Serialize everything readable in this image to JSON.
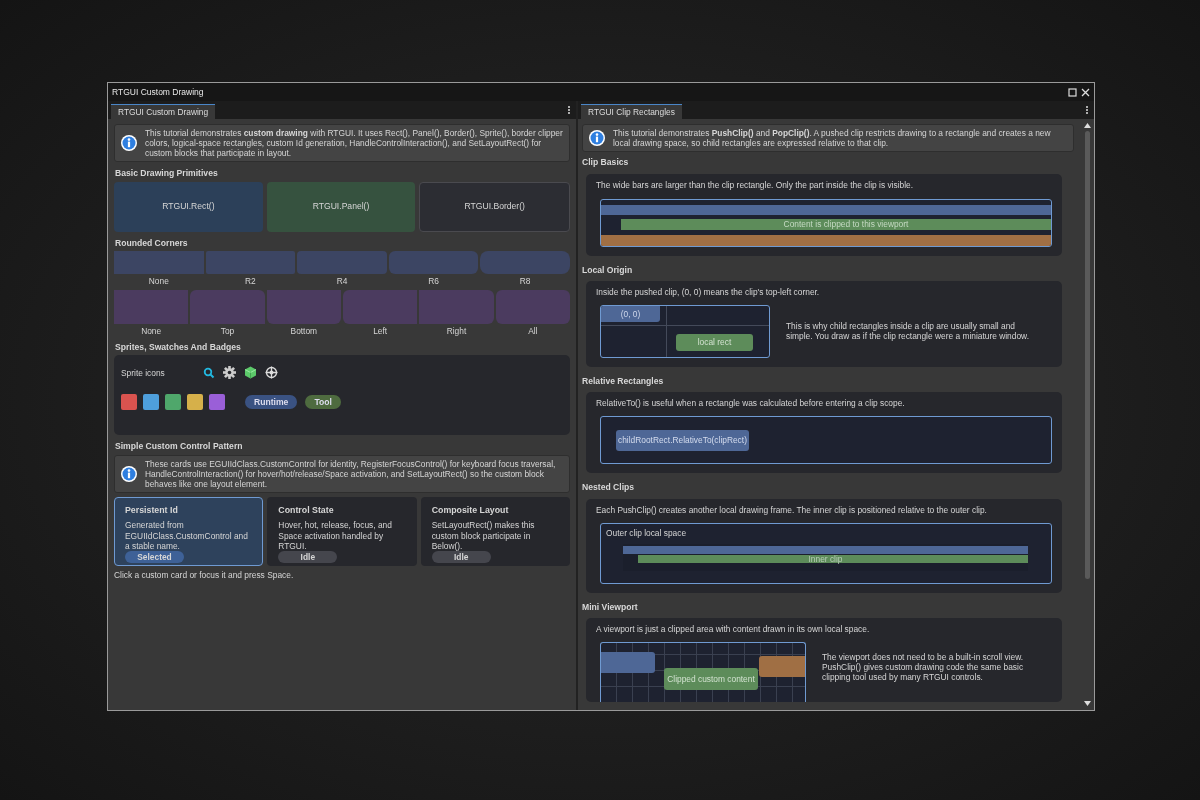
{
  "window": {
    "title": "RTGUI Custom Drawing"
  },
  "left_panel": {
    "tab": {
      "label": "RTGUI Custom Drawing",
      "selected": true
    },
    "intro": "This tutorial demonstrates **custom drawing** with RTGUI. It uses Rect(), Panel(), Border(), Sprite(), border clipper colors, logical-space rectangles, custom Id generation, HandleControlInteraction(), and SetLayoutRect() for custom blocks that participate in layout.",
    "primitives": {
      "heading": "Basic Drawing Primitives",
      "items": [
        {
          "label": "RTGUI.Rect()",
          "kind": "rect"
        },
        {
          "label": "RTGUI.Panel()",
          "kind": "panel"
        },
        {
          "label": "RTGUI.Border()",
          "kind": "border"
        }
      ]
    },
    "rounded": {
      "heading": "Rounded Corners",
      "radius_row": [
        {
          "label": "None",
          "kind": "r0"
        },
        {
          "label": "R2",
          "kind": "r2"
        },
        {
          "label": "R4",
          "kind": "r4"
        },
        {
          "label": "R6",
          "kind": "r6"
        },
        {
          "label": "R8",
          "kind": "r8"
        }
      ],
      "side_row": [
        {
          "label": "None",
          "kind": "none"
        },
        {
          "label": "Top",
          "kind": "top"
        },
        {
          "label": "Bottom",
          "kind": "bottom"
        },
        {
          "label": "Left",
          "kind": "left"
        },
        {
          "label": "Right",
          "kind": "right"
        },
        {
          "label": "All",
          "kind": "all"
        }
      ]
    },
    "sprites": {
      "heading": "Sprites, Swatches And Badges",
      "label": "Sprite icons",
      "swatches": [
        {
          "color": "#d9534f"
        },
        {
          "color": "#4e9fdc"
        },
        {
          "color": "#4fa76b"
        },
        {
          "color": "#d6b04a"
        },
        {
          "color": "#9a5fd8"
        }
      ],
      "badges": [
        {
          "label": "Runtime",
          "color": "#3a5282"
        },
        {
          "label": "Tool",
          "color": "#4e6b3f"
        }
      ]
    },
    "pattern": {
      "heading": "Simple Custom Control Pattern",
      "note": "These cards use EGUIIdClass.CustomControl for identity, RegisterFocusControl() for keyboard focus traversal, HandleControlInteraction() for hover/hot/release/Space activation, and SetLayoutRect() so the custom block behaves like one layout element.",
      "cards": [
        {
          "title": "Persistent Id",
          "text": "Generated from EGUIIdClass.CustomControl and a stable name.",
          "status": "Selected",
          "selected": true
        },
        {
          "title": "Control State",
          "text": "Hover, hot, release, focus, and Space activation handled by RTGUI.",
          "status": "Idle",
          "selected": false
        },
        {
          "title": "Composite Layout",
          "text": "SetLayoutRect() makes this custom block participate in Below().",
          "status": "Idle",
          "selected": false
        }
      ],
      "hint": "Click a custom card or focus it and press Space."
    }
  },
  "right_panel": {
    "tab": {
      "label": "RTGUI Clip Rectangles",
      "selected": true
    },
    "intro": "This tutorial demonstrates **PushClip()** and **PopClip()**. A pushed clip restricts drawing to a rectangle and creates a new local drawing space, so child rectangles are expressed relative to that clip.",
    "sections": [
      {
        "kind": "clip_basics",
        "heading": "Clip Basics",
        "caption": "The wide bars are larger than the clip rectangle. Only the part inside the clip is visible.",
        "bar_label": "Content is clipped to this viewport"
      },
      {
        "kind": "local_origin",
        "heading": "Local Origin",
        "caption": "Inside the pushed clip, (0, 0) means the clip's top-left corner.",
        "origin_label": "(0, 0)",
        "rect_label": "local rect",
        "text": "This is why child rectangles inside a clip are usually small and simple. You draw as if the clip rectangle were a miniature window."
      },
      {
        "kind": "relative",
        "heading": "Relative Rectangles",
        "caption": "RelativeTo() is useful when a rectangle was calculated before entering a clip scope.",
        "rect_label": "childRootRect.RelativeTo(clipRect)"
      },
      {
        "kind": "nested",
        "heading": "Nested Clips",
        "caption": "Each PushClip() creates another local drawing frame. The inner clip is positioned relative to the outer clip.",
        "outer_label": "Outer clip local space",
        "inner_label": "Inner clip"
      },
      {
        "kind": "viewport",
        "heading": "Mini Viewport",
        "caption": "A viewport is just a clipped area with content drawn in its own local space.",
        "content_label": "Clipped custom content",
        "text": "The viewport does not need to be a built-in scroll view. PushClip() gives custom drawing code the same basic clipping tool used by many RTGUI controls."
      }
    ]
  }
}
